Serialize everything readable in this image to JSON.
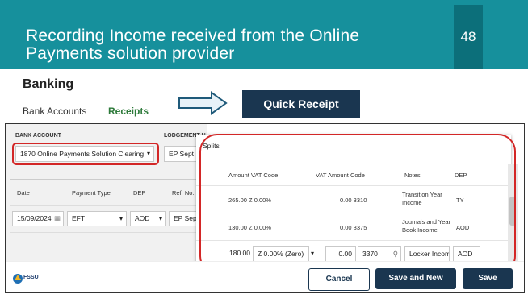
{
  "slide": {
    "title": "Recording Income received from the Online Payments solution provider",
    "page_number": "48",
    "colors": {
      "header": "#16909c",
      "page_badge": "#0c6f7a",
      "highlight": "#d32727",
      "button_dark": "#1a3650"
    }
  },
  "banking": {
    "heading": "Banking",
    "nav_bank_accounts": "Bank Accounts",
    "nav_receipts": "Receipts"
  },
  "quick_receipt_label": "Quick Receipt",
  "form": {
    "bank_account_label": "BANK ACCOUNT",
    "bank_account_value": "1870 Online Payments Solution Clearing",
    "lodgement_label": "LODGEMENT N",
    "lodgement_value": "EP Sept",
    "columns": {
      "date": "Date",
      "payment_type": "Payment Type",
      "dep": "DEP",
      "ref_no": "Ref. No."
    },
    "row": {
      "date": "15/09/2024",
      "payment_type": "EFT",
      "dep": "AOD",
      "ref_no": "EP Sept"
    }
  },
  "splits": {
    "title": "Splits",
    "columns": {
      "amount_vat": "Amount VAT Code",
      "vat_amount_code": "VAT Amount Code",
      "notes": "Notes",
      "dep": "DEP"
    },
    "rows": [
      {
        "amount_vat": "265.00 Z 0.00%",
        "vat_amount_code": "0.00 3310",
        "notes": "Transition Year Income",
        "dep": "TY"
      },
      {
        "amount_vat": "130.00 Z 0.00%",
        "vat_amount_code": "0.00 3375",
        "notes": "Journals and Year Book Income",
        "dep": "AOD"
      }
    ],
    "edit_row": {
      "amount": "180.00",
      "vat_code": "Z 0.00% (Zero)",
      "vat_amount": "0.00",
      "code": "3370",
      "notes": "Locker Income",
      "dep": "AOD"
    }
  },
  "buttons": {
    "cancel": "Cancel",
    "save_and_new": "Save and New",
    "save": "Save"
  },
  "logo_text": "FSSU"
}
